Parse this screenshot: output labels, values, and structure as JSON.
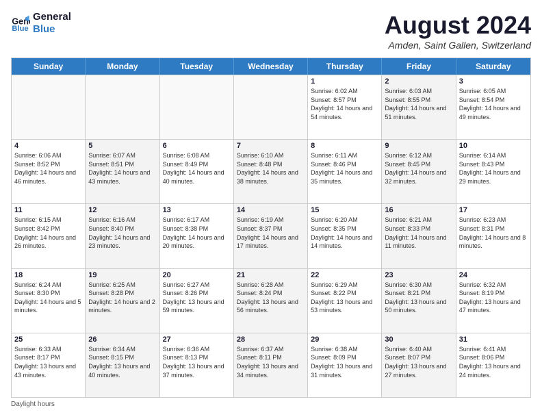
{
  "logo": {
    "line1": "General",
    "line2": "Blue"
  },
  "title": "August 2024",
  "location": "Amden, Saint Gallen, Switzerland",
  "days_of_week": [
    "Sunday",
    "Monday",
    "Tuesday",
    "Wednesday",
    "Thursday",
    "Friday",
    "Saturday"
  ],
  "footer": "Daylight hours",
  "weeks": [
    [
      {
        "day": "",
        "info": "",
        "alt": false,
        "empty": true
      },
      {
        "day": "",
        "info": "",
        "alt": false,
        "empty": true
      },
      {
        "day": "",
        "info": "",
        "alt": false,
        "empty": true
      },
      {
        "day": "",
        "info": "",
        "alt": false,
        "empty": true
      },
      {
        "day": "1",
        "info": "Sunrise: 6:02 AM\nSunset: 8:57 PM\nDaylight: 14 hours\nand 54 minutes.",
        "alt": false,
        "empty": false
      },
      {
        "day": "2",
        "info": "Sunrise: 6:03 AM\nSunset: 8:55 PM\nDaylight: 14 hours\nand 51 minutes.",
        "alt": true,
        "empty": false
      },
      {
        "day": "3",
        "info": "Sunrise: 6:05 AM\nSunset: 8:54 PM\nDaylight: 14 hours\nand 49 minutes.",
        "alt": false,
        "empty": false
      }
    ],
    [
      {
        "day": "4",
        "info": "Sunrise: 6:06 AM\nSunset: 8:52 PM\nDaylight: 14 hours\nand 46 minutes.",
        "alt": false,
        "empty": false
      },
      {
        "day": "5",
        "info": "Sunrise: 6:07 AM\nSunset: 8:51 PM\nDaylight: 14 hours\nand 43 minutes.",
        "alt": true,
        "empty": false
      },
      {
        "day": "6",
        "info": "Sunrise: 6:08 AM\nSunset: 8:49 PM\nDaylight: 14 hours\nand 40 minutes.",
        "alt": false,
        "empty": false
      },
      {
        "day": "7",
        "info": "Sunrise: 6:10 AM\nSunset: 8:48 PM\nDaylight: 14 hours\nand 38 minutes.",
        "alt": true,
        "empty": false
      },
      {
        "day": "8",
        "info": "Sunrise: 6:11 AM\nSunset: 8:46 PM\nDaylight: 14 hours\nand 35 minutes.",
        "alt": false,
        "empty": false
      },
      {
        "day": "9",
        "info": "Sunrise: 6:12 AM\nSunset: 8:45 PM\nDaylight: 14 hours\nand 32 minutes.",
        "alt": true,
        "empty": false
      },
      {
        "day": "10",
        "info": "Sunrise: 6:14 AM\nSunset: 8:43 PM\nDaylight: 14 hours\nand 29 minutes.",
        "alt": false,
        "empty": false
      }
    ],
    [
      {
        "day": "11",
        "info": "Sunrise: 6:15 AM\nSunset: 8:42 PM\nDaylight: 14 hours\nand 26 minutes.",
        "alt": false,
        "empty": false
      },
      {
        "day": "12",
        "info": "Sunrise: 6:16 AM\nSunset: 8:40 PM\nDaylight: 14 hours\nand 23 minutes.",
        "alt": true,
        "empty": false
      },
      {
        "day": "13",
        "info": "Sunrise: 6:17 AM\nSunset: 8:38 PM\nDaylight: 14 hours\nand 20 minutes.",
        "alt": false,
        "empty": false
      },
      {
        "day": "14",
        "info": "Sunrise: 6:19 AM\nSunset: 8:37 PM\nDaylight: 14 hours\nand 17 minutes.",
        "alt": true,
        "empty": false
      },
      {
        "day": "15",
        "info": "Sunrise: 6:20 AM\nSunset: 8:35 PM\nDaylight: 14 hours\nand 14 minutes.",
        "alt": false,
        "empty": false
      },
      {
        "day": "16",
        "info": "Sunrise: 6:21 AM\nSunset: 8:33 PM\nDaylight: 14 hours\nand 11 minutes.",
        "alt": true,
        "empty": false
      },
      {
        "day": "17",
        "info": "Sunrise: 6:23 AM\nSunset: 8:31 PM\nDaylight: 14 hours\nand 8 minutes.",
        "alt": false,
        "empty": false
      }
    ],
    [
      {
        "day": "18",
        "info": "Sunrise: 6:24 AM\nSunset: 8:30 PM\nDaylight: 14 hours\nand 5 minutes.",
        "alt": false,
        "empty": false
      },
      {
        "day": "19",
        "info": "Sunrise: 6:25 AM\nSunset: 8:28 PM\nDaylight: 14 hours\nand 2 minutes.",
        "alt": true,
        "empty": false
      },
      {
        "day": "20",
        "info": "Sunrise: 6:27 AM\nSunset: 8:26 PM\nDaylight: 13 hours\nand 59 minutes.",
        "alt": false,
        "empty": false
      },
      {
        "day": "21",
        "info": "Sunrise: 6:28 AM\nSunset: 8:24 PM\nDaylight: 13 hours\nand 56 minutes.",
        "alt": true,
        "empty": false
      },
      {
        "day": "22",
        "info": "Sunrise: 6:29 AM\nSunset: 8:22 PM\nDaylight: 13 hours\nand 53 minutes.",
        "alt": false,
        "empty": false
      },
      {
        "day": "23",
        "info": "Sunrise: 6:30 AM\nSunset: 8:21 PM\nDaylight: 13 hours\nand 50 minutes.",
        "alt": true,
        "empty": false
      },
      {
        "day": "24",
        "info": "Sunrise: 6:32 AM\nSunset: 8:19 PM\nDaylight: 13 hours\nand 47 minutes.",
        "alt": false,
        "empty": false
      }
    ],
    [
      {
        "day": "25",
        "info": "Sunrise: 6:33 AM\nSunset: 8:17 PM\nDaylight: 13 hours\nand 43 minutes.",
        "alt": false,
        "empty": false
      },
      {
        "day": "26",
        "info": "Sunrise: 6:34 AM\nSunset: 8:15 PM\nDaylight: 13 hours\nand 40 minutes.",
        "alt": true,
        "empty": false
      },
      {
        "day": "27",
        "info": "Sunrise: 6:36 AM\nSunset: 8:13 PM\nDaylight: 13 hours\nand 37 minutes.",
        "alt": false,
        "empty": false
      },
      {
        "day": "28",
        "info": "Sunrise: 6:37 AM\nSunset: 8:11 PM\nDaylight: 13 hours\nand 34 minutes.",
        "alt": true,
        "empty": false
      },
      {
        "day": "29",
        "info": "Sunrise: 6:38 AM\nSunset: 8:09 PM\nDaylight: 13 hours\nand 31 minutes.",
        "alt": false,
        "empty": false
      },
      {
        "day": "30",
        "info": "Sunrise: 6:40 AM\nSunset: 8:07 PM\nDaylight: 13 hours\nand 27 minutes.",
        "alt": true,
        "empty": false
      },
      {
        "day": "31",
        "info": "Sunrise: 6:41 AM\nSunset: 8:06 PM\nDaylight: 13 hours\nand 24 minutes.",
        "alt": false,
        "empty": false
      }
    ]
  ]
}
